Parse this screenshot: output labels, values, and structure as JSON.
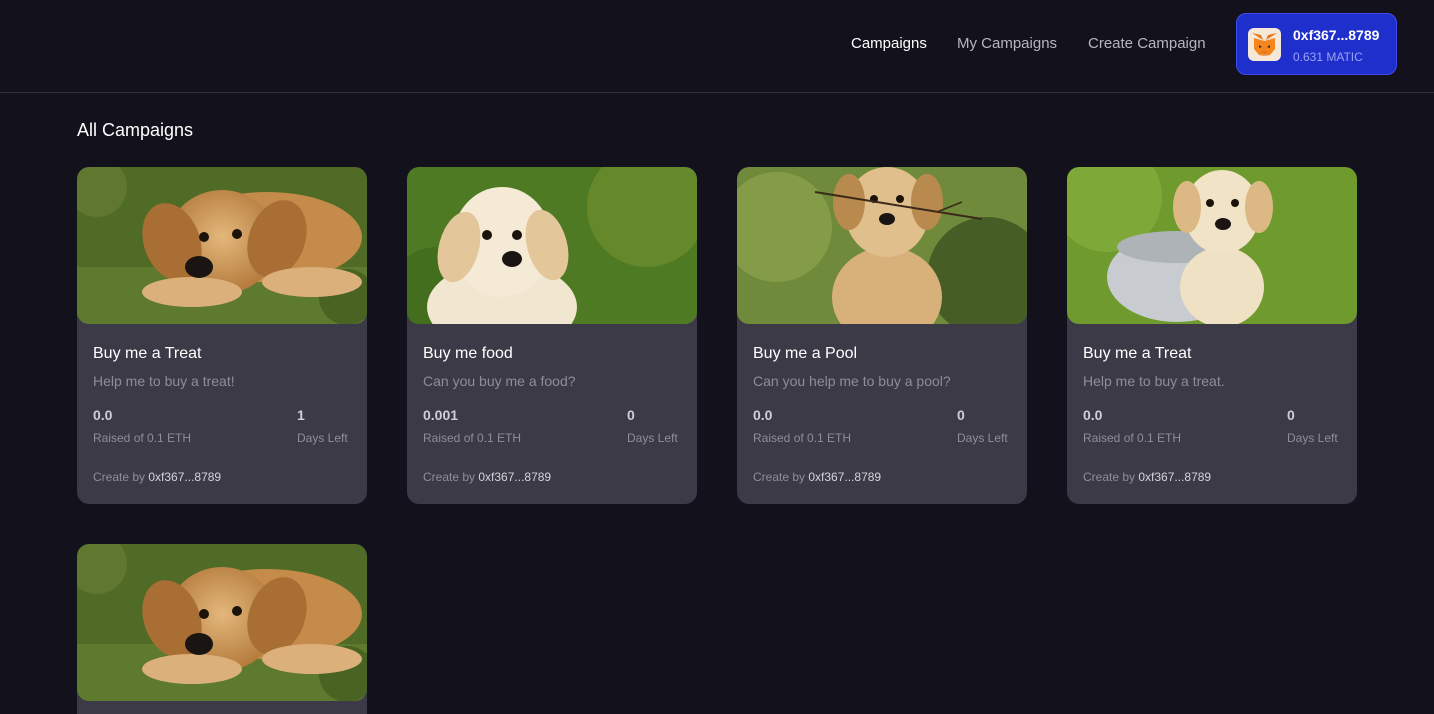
{
  "nav": {
    "links": [
      "Campaigns",
      "My Campaigns",
      "Create Campaign"
    ],
    "active": "Campaigns"
  },
  "wallet": {
    "address": "0xf367...8789",
    "balance": "0.631 MATIC",
    "icon": "metamask-fox-icon",
    "color": "#1e2fcc"
  },
  "section": {
    "title": "All Campaigns"
  },
  "campaigns": [
    {
      "title": "Buy me a Treat",
      "description": "Help me to buy a treat!",
      "raised": "0.0",
      "raised_label": "Raised of 0.1 ETH",
      "days": "1",
      "days_label": "Days Left",
      "creator_prefix": "Create by",
      "creator": "0xf367...8789",
      "image": "puppy-lying-in-grass"
    },
    {
      "title": "Buy me food",
      "description": "Can you buy me a food?",
      "raised": "0.001",
      "raised_label": "Raised of 0.1 ETH",
      "days": "0",
      "days_label": "Days Left",
      "creator_prefix": "Create by",
      "creator": "0xf367...8789",
      "image": "puppy-sitting-on-lawn"
    },
    {
      "title": "Buy me a Pool",
      "description": "Can you help me to buy a pool?",
      "raised": "0.0",
      "raised_label": "Raised of 0.1 ETH",
      "days": "0",
      "days_label": "Days Left",
      "creator_prefix": "Create by",
      "creator": "0xf367...8789",
      "image": "puppy-with-stick"
    },
    {
      "title": "Buy me a Treat",
      "description": "Help me to buy a treat.",
      "raised": "0.0",
      "raised_label": "Raised of 0.1 ETH",
      "days": "0",
      "days_label": "Days Left",
      "creator_prefix": "Create by",
      "creator": "0xf367...8789",
      "image": "puppy-in-bowl"
    },
    {
      "image": "puppy-lying-in-grass"
    }
  ]
}
